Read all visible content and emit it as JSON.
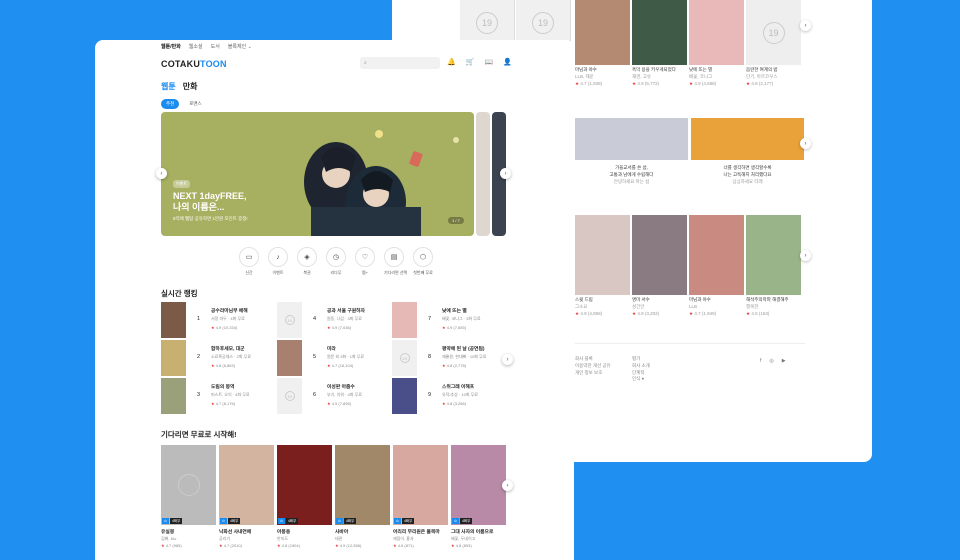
{
  "bg": {
    "cards_top": [
      {
        "title": "마님과 야수",
        "sub": "LLB, 재운",
        "rating": "4.7 (1,938)"
      },
      {
        "title": "흑막 용을 키우게되었다",
        "sub": "재경, 고유",
        "rating": "4.9 (5,772)"
      },
      {
        "title": "낮에 뜨는 별",
        "sub": "배꽃, 코니그",
        "rating": "4.9 (4,688)"
      },
      {
        "title": "음란한 여계의 밤",
        "sub": "단기, 마르코우스",
        "rating": "4.8 (2,177)"
      }
    ],
    "banner_texts": [
      {
        "line1": "가을교서를 쓴 섬,",
        "line2": "고통과 남에게 수립해다",
        "sub": "안녕하세요 마는 섬"
      },
      {
        "line1": "너를 생각하면 생각할수록",
        "line2": "나는 고독해지 처리했다요",
        "sub": "심심하세요 타래"
      }
    ],
    "cards_mid": [
      {
        "title": "스윗 드림",
        "sub": "그소요",
        "rating": "4.9 (4,858)"
      },
      {
        "title": "명미 서수",
        "sub": "성긴안",
        "rating": "4.9 (3,202)"
      },
      {
        "title": "마님과 야수",
        "sub": "LLB",
        "rating": "4.7 (1,949)"
      },
      {
        "title": "해석주의학파 해결해주",
        "sub": "행복한",
        "rating": "4.5 (163)"
      }
    ],
    "footer": {
      "left": [
        "회사 블록",
        "이용약관 개선 공유",
        "개인 정보 보호"
      ],
      "right": [
        "평가",
        "회사 소개",
        "단계적",
        "인식 ●"
      ],
      "social": [
        "f",
        "◎",
        "▶"
      ]
    }
  },
  "header": {
    "top_nav": [
      "웹툰/만화",
      "웹소설",
      "도서",
      "블록체인 ⌄"
    ],
    "logo_a": "COTAKU",
    "logo_b": "TOON",
    "search_icon": "⌕",
    "icons": [
      "🔔",
      "🛒",
      "📖",
      "👤"
    ]
  },
  "categories": [
    "웹툰",
    "만화"
  ],
  "pills": [
    "추천",
    "로맨스"
  ],
  "banner": {
    "tag": "이벤트",
    "title_line1": "NEXT 1dayFREE,",
    "title_line2": "나의 이름은...",
    "subtitle": "5억에 웹탑 공유하면 1만원 포인트 증정!",
    "counter": "1 / 7"
  },
  "quick_menu": [
    {
      "icon": "▭",
      "label": "신간"
    },
    {
      "icon": "♪",
      "label": "이벤트"
    },
    {
      "icon": "◈",
      "label": "복권"
    },
    {
      "icon": "◷",
      "label": "리다무"
    },
    {
      "icon": "♡",
      "label": "찜+"
    },
    {
      "icon": "▤",
      "label": "기다리면 선택"
    },
    {
      "icon": "⬡",
      "label": "첫번째 무료"
    }
  ],
  "ranking": {
    "title": "실시간 랭킹",
    "items": [
      {
        "rank": "1",
        "title": "공수라마님부 애해",
        "sub": "서정 미두 · 4화 무료",
        "rating": "4.9 (10,334)"
      },
      {
        "rank": "2",
        "title": "합하후세모, 대군",
        "sub": "소료흑공채스 · 2화 무료",
        "rating": "4.8 (6,863)"
      },
      {
        "rank": "3",
        "title": "도림의 몽역",
        "sub": "머스트, 오이 · 4화 무료",
        "rating": "4.7 (8,176)"
      },
      {
        "rank": "4",
        "title": "공과 서울 구원하자",
        "sub": "원동, 나감 · 3화 무료",
        "rating": "4.9 (7,036)"
      },
      {
        "rank": "5",
        "title": "미라",
        "sub": "원문 외 3화 · 1화 무료",
        "rating": "4.7 (16,104)"
      },
      {
        "rank": "6",
        "title": "이성판 아줌수",
        "sub": "부기, 치워 · 4화 무료",
        "rating": "4.9 (7,896)"
      },
      {
        "rank": "7",
        "title": "낮에 뜨는 별",
        "sub": "배꽃, 코니그 · 3화 무료",
        "rating": "4.9 (7,655)"
      },
      {
        "rank": "8",
        "title": "평약에 된 날 (공연됨)",
        "sub": "재롱원, 현대빠 · 10화 무료",
        "rating": "4.8 (2,778)"
      },
      {
        "rank": "9",
        "title": "스위그레 이해프",
        "sub": "유작/추상 · 10화 무료",
        "rating": "4.8 (3,286)"
      }
    ]
  },
  "free": {
    "title": "기다리면 무료로 시작해!",
    "items": [
      {
        "title": "유실몽",
        "sub": "김뻐, Kiu",
        "rating": "4.7 (985)"
      },
      {
        "title": "낙화선 사내연애",
        "sub": "공리기",
        "rating": "4.7 (2010)"
      },
      {
        "title": "아몽용",
        "sub": "반지도",
        "rating": "4.8 (1904)"
      },
      {
        "title": "사바아",
        "sub": "태관",
        "rating": "4.9 (12,556)"
      },
      {
        "title": "어리리 무리원은 물목마",
        "sub": "재점이, 홍자",
        "rating": "4.6 (871)"
      },
      {
        "title": "그대 사자의 이름으로",
        "sub": "배꽃, 두네이고",
        "rating": "4.8 (893)"
      }
    ]
  },
  "badges": {
    "wait": "⊙",
    "free": "4화무"
  },
  "placeholder_19": "19",
  "colors": {
    "accent": "#1a8cf0",
    "background": "#1f8ff2",
    "star": "#e33333"
  }
}
